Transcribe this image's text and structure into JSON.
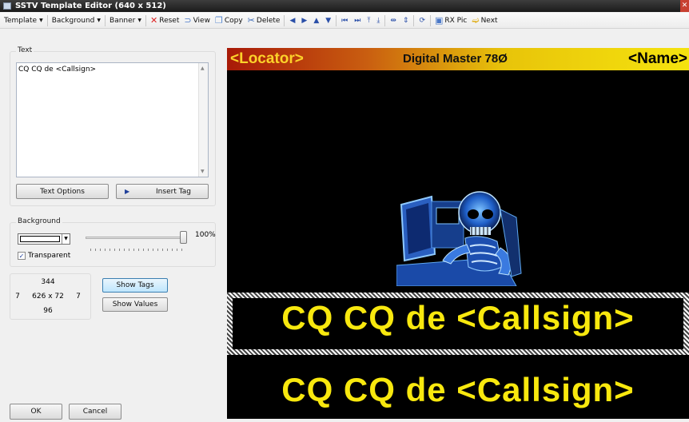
{
  "window": {
    "title": "SSTV Template Editor (640 x 512)"
  },
  "toolbar": {
    "template": "Template",
    "background": "Background",
    "banner": "Banner",
    "reset": "Reset",
    "view": "View",
    "copy": "Copy",
    "delete": "Delete",
    "rx_pic": "RX Pic",
    "next": "Next"
  },
  "text_group": {
    "label": "Text",
    "value": "CQ CQ de <Callsign>",
    "text_options": "Text Options",
    "insert_tag": "Insert Tag"
  },
  "background_group": {
    "label": "Background",
    "color": "#ffffff",
    "opacity_label": "100%",
    "opacity_value": 100,
    "transparent_label": "Transparent",
    "transparent_checked": true
  },
  "dimensions": {
    "top": "344",
    "left": "7",
    "size": "626 x 72",
    "right": "7",
    "bottom": "96"
  },
  "buttons": {
    "show_tags": "Show Tags",
    "show_values": "Show Values",
    "ok": "OK",
    "cancel": "Cancel"
  },
  "preview": {
    "banner_left": "<Locator>",
    "banner_center": "Digital Master 78Ø",
    "banner_right": "<Name>",
    "text_1": "CQ CQ de <Callsign>",
    "text_2": "CQ CQ de <Callsign>"
  }
}
